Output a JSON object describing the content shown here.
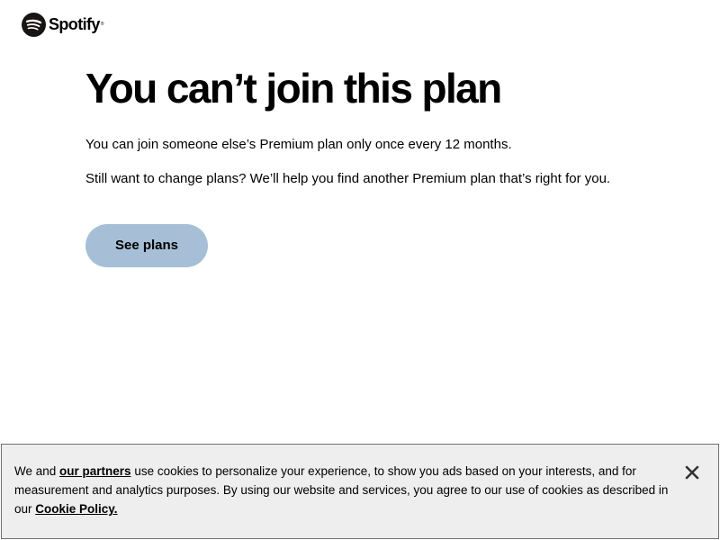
{
  "brand": {
    "name": "Spotify",
    "trademark": "®",
    "logo_icon": "spotify-logo-icon",
    "color": "#191414"
  },
  "main": {
    "title": "You can’t join this plan",
    "paragraph1": "You can join someone else’s Premium plan only once every 12 months.",
    "paragraph2": "Still want to change plans? We’ll help you find another Premium plan that’s right for you.",
    "cta_label": "See plans",
    "cta_color": "#a7bfd6"
  },
  "cookie_banner": {
    "text_before_partners": "We and ",
    "partners_link": "our partners",
    "text_after_partners": " use cookies to personalize your experience, to show you ads based on your interests, and for measurement and analytics purposes. By using our website and services, you agree to our use of cookies as described in our ",
    "policy_link": "Cookie Policy.",
    "close_icon": "close-icon",
    "background": "#eeeeee"
  }
}
